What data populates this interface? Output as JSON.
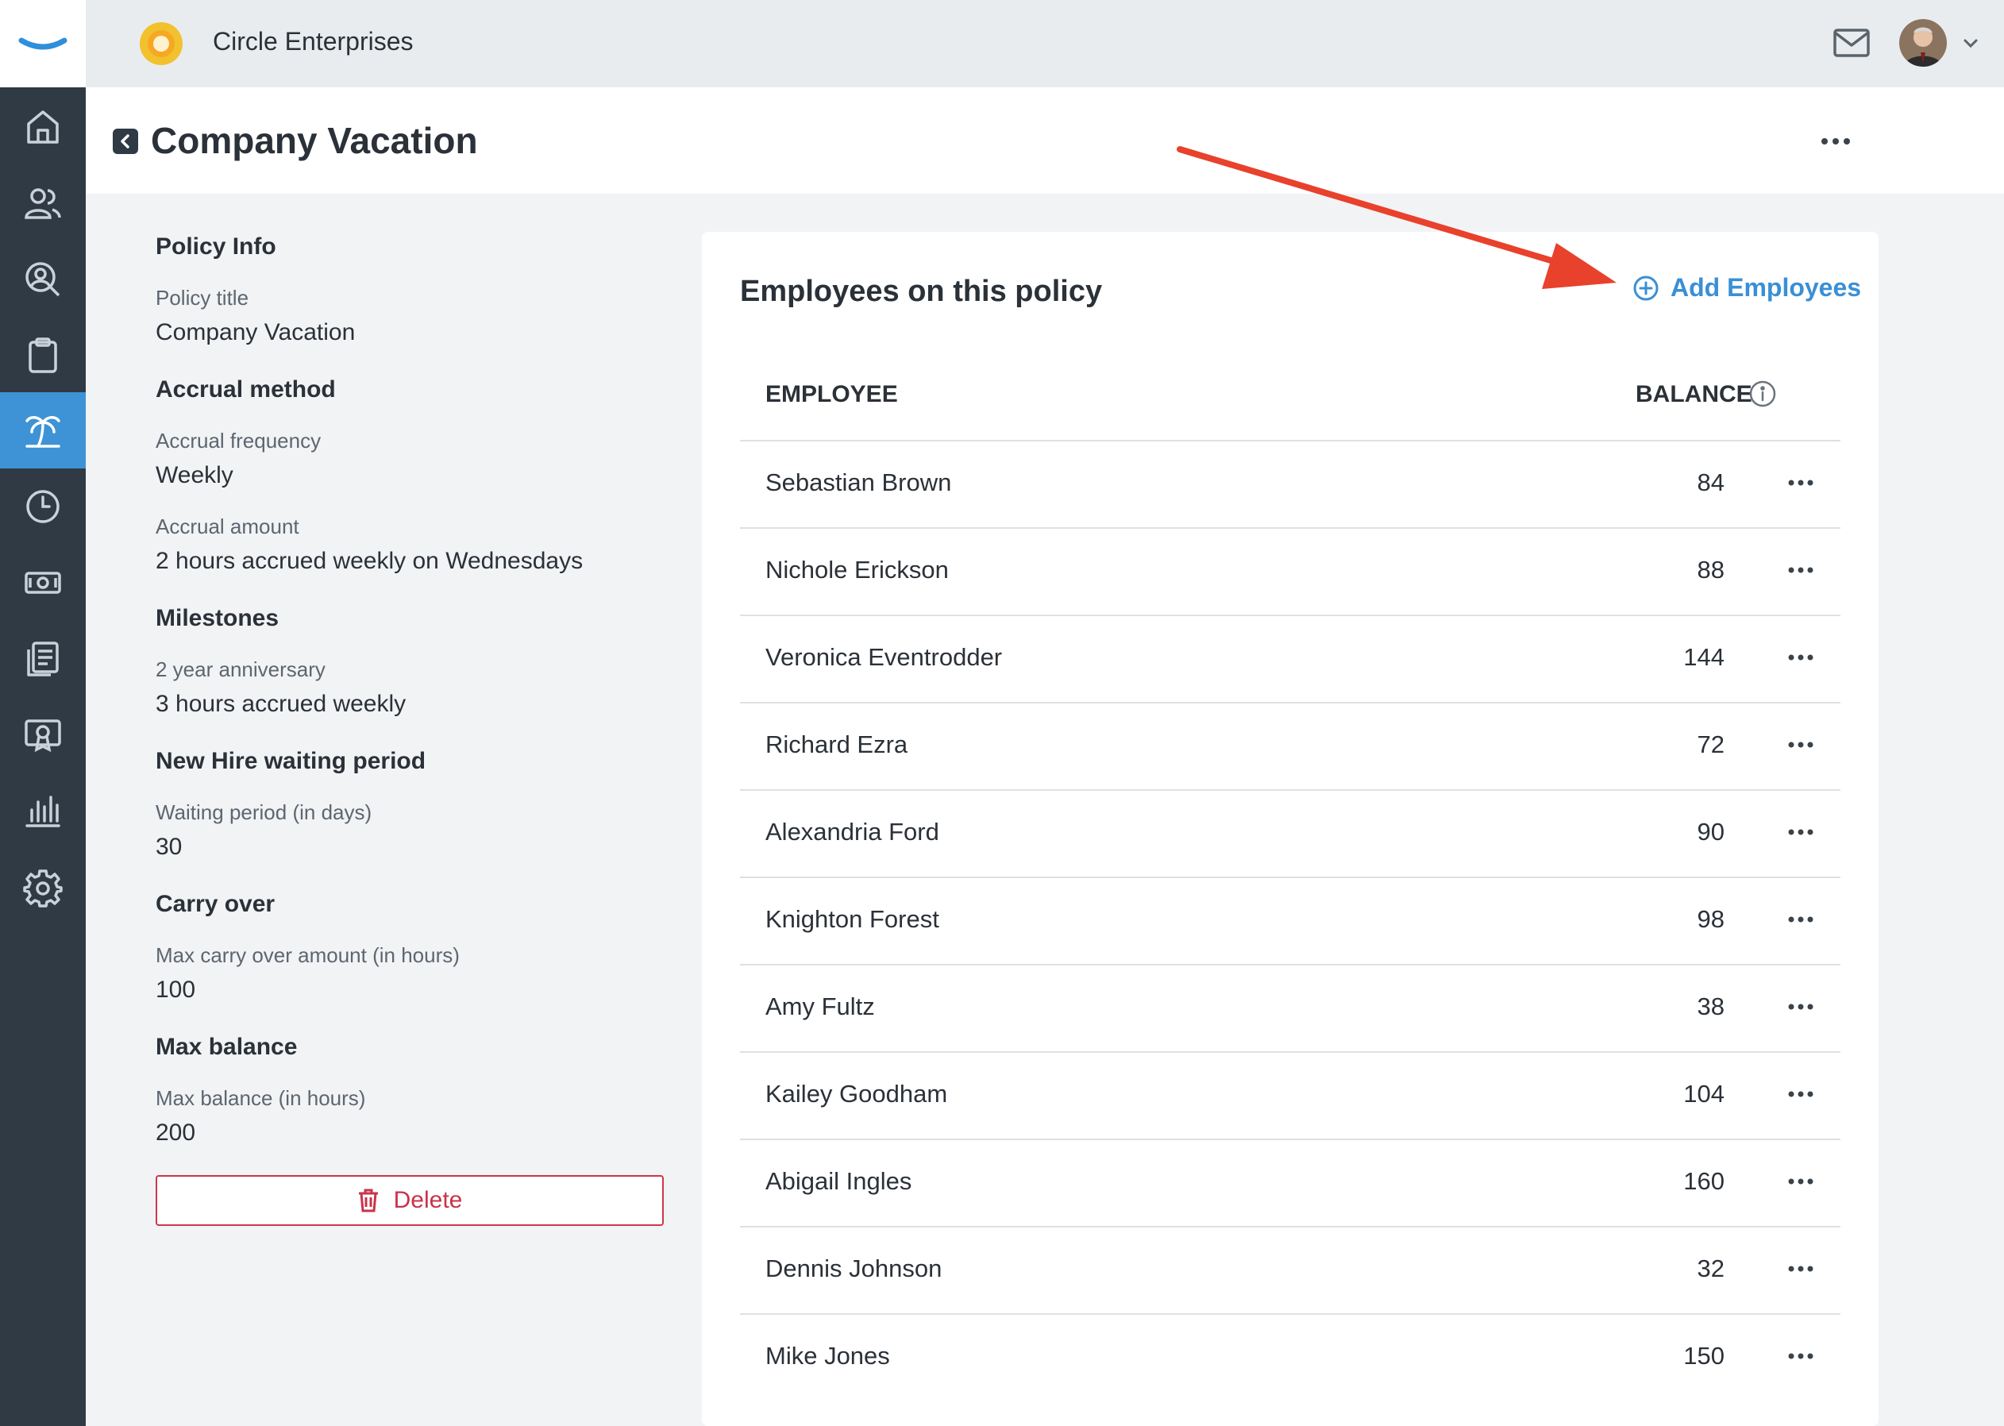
{
  "topbar": {
    "company_name": "Circle Enterprises",
    "icons": [
      "mail-icon",
      "avatar",
      "chevron-down-icon"
    ]
  },
  "sidebar": {
    "items": [
      {
        "icon": "home-icon"
      },
      {
        "icon": "people-icon"
      },
      {
        "icon": "search-person-icon"
      },
      {
        "icon": "clipboard-icon"
      },
      {
        "icon": "palm-tree-icon",
        "active": true
      },
      {
        "icon": "clock-icon"
      },
      {
        "icon": "money-icon"
      },
      {
        "icon": "documents-icon"
      },
      {
        "icon": "certificate-icon"
      },
      {
        "icon": "bar-chart-icon"
      },
      {
        "icon": "gear-icon"
      }
    ]
  },
  "header": {
    "title": "Company Vacation"
  },
  "policy": {
    "policy_info_title": "Policy Info",
    "policy_title_label": "Policy title",
    "policy_title_value": "Company Vacation",
    "accrual_method_title": "Accrual method",
    "accrual_frequency_label": "Accrual frequency",
    "accrual_frequency_value": "Weekly",
    "accrual_amount_label": "Accrual amount",
    "accrual_amount_value": "2 hours accrued weekly on Wednesdays",
    "milestones_title": "Milestones",
    "milestone_label": "2 year anniversary",
    "milestone_value": "3 hours accrued weekly",
    "new_hire_title": "New Hire waiting period",
    "waiting_period_label": "Waiting period (in days)",
    "waiting_period_value": "30",
    "carry_over_title": "Carry over",
    "carry_over_label": "Max carry over amount (in hours)",
    "carry_over_value": "100",
    "max_balance_title": "Max balance",
    "max_balance_label": "Max balance (in hours)",
    "max_balance_value": "200",
    "delete_label": "Delete"
  },
  "employees": {
    "title": "Employees on this policy",
    "add_label": "Add Employees",
    "columns": {
      "employee": "EMPLOYEE",
      "balance": "BALANCE"
    },
    "rows": [
      {
        "name": "Sebastian Brown",
        "balance": "84"
      },
      {
        "name": "Nichole Erickson",
        "balance": "88"
      },
      {
        "name": "Veronica Eventrodder",
        "balance": "144"
      },
      {
        "name": "Richard Ezra",
        "balance": "72"
      },
      {
        "name": "Alexandria Ford",
        "balance": "90"
      },
      {
        "name": "Knighton Forest",
        "balance": "98"
      },
      {
        "name": "Amy Fultz",
        "balance": "38"
      },
      {
        "name": "Kailey Goodham",
        "balance": "104"
      },
      {
        "name": "Abigail Ingles",
        "balance": "160"
      },
      {
        "name": "Dennis Johnson",
        "balance": "32"
      },
      {
        "name": "Mike Jones",
        "balance": "150"
      }
    ]
  },
  "colors": {
    "sidebar_bg": "#2f3a45",
    "accent": "#3d93d6",
    "link": "#3a8fd6",
    "danger": "#c8334a",
    "annotation_arrow": "#e8412c"
  }
}
